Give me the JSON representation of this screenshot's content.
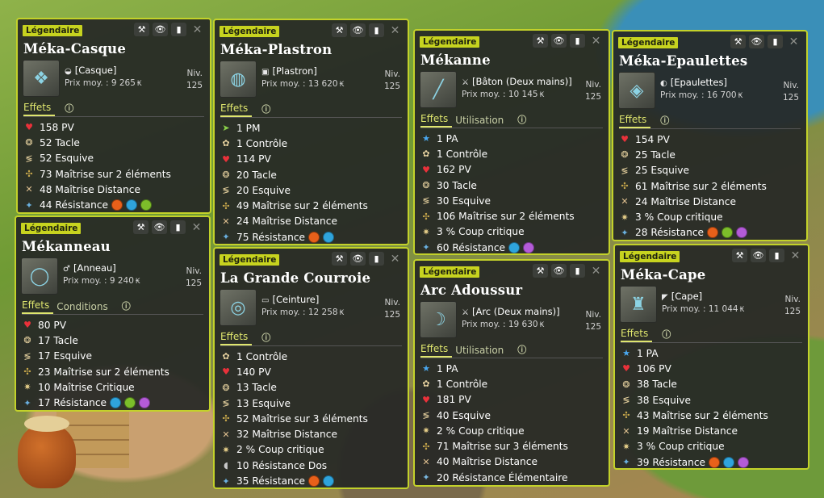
{
  "tooltip_buttons": {
    "craft": "⚒",
    "view": "👁",
    "book": "▮",
    "close": "✕"
  },
  "element_colors": {
    "fire": "#e8601a",
    "water": "#2fa4dc",
    "earth": "#7cbe2a",
    "air": "#b45bd8"
  },
  "stat_icon_glyphs": {
    "pv": "♥",
    "tacle": "❂",
    "esquive": "≶",
    "maitrise": "✣",
    "distance": "✕",
    "resistance": "✦",
    "pm": "➤",
    "controle": "✿",
    "pa": "★",
    "critique": "✷",
    "res_dos": "◖",
    "res_elem": "✦",
    "maitrise_crit": "✷"
  },
  "stat_icon_colors": {
    "pv": "#e9313a",
    "tacle": "#e8d3a0",
    "esquive": "#e8d3a0",
    "maitrise": "#c8a84c",
    "distance": "#e0c090",
    "resistance": "#6ab0e0",
    "pm": "#8bd14a",
    "controle": "#e8d3a0",
    "pa": "#4aa8f0",
    "critique": "#e8d08a",
    "res_dos": "#c8c8c8",
    "res_elem": "#7ab8e0",
    "maitrise_crit": "#e8d08a"
  },
  "items": [
    {
      "rarity": "Légendaire",
      "name": "Méka-Casque",
      "type": "[Casque]",
      "type_icon": "helmet-icon",
      "price_label": "Prix moy. :",
      "price": "9 265",
      "level_label": "Niv.",
      "level": "125",
      "tabs": [
        "Effets"
      ],
      "stats": [
        {
          "icon": "pv",
          "text": "158 PV"
        },
        {
          "icon": "tacle",
          "text": "52 Tacle"
        },
        {
          "icon": "esquive",
          "text": "52 Esquive"
        },
        {
          "icon": "maitrise",
          "text": "73 Maîtrise sur 2 éléments"
        },
        {
          "icon": "distance",
          "text": "48 Maîtrise Distance"
        },
        {
          "icon": "resistance",
          "text": "44 Résistance",
          "elements": [
            "fire",
            "water",
            "earth"
          ]
        }
      ]
    },
    {
      "rarity": "Légendaire",
      "name": "Méka-Plastron",
      "type": "[Plastron]",
      "type_icon": "breastplate-icon",
      "price_label": "Prix moy. :",
      "price": "13 620",
      "level_label": "Niv.",
      "level": "125",
      "tabs": [
        "Effets"
      ],
      "stats": [
        {
          "icon": "pm",
          "text": "1 PM"
        },
        {
          "icon": "controle",
          "text": "1 Contrôle"
        },
        {
          "icon": "pv",
          "text": "114 PV"
        },
        {
          "icon": "tacle",
          "text": "20 Tacle"
        },
        {
          "icon": "esquive",
          "text": "20 Esquive"
        },
        {
          "icon": "maitrise",
          "text": "49 Maîtrise sur 2 éléments"
        },
        {
          "icon": "distance",
          "text": "24 Maîtrise Distance"
        },
        {
          "icon": "resistance",
          "text": "75 Résistance",
          "elements": [
            "fire",
            "water"
          ]
        }
      ]
    },
    {
      "rarity": "Légendaire",
      "name": "Mékanne",
      "type": "[Bâton (Deux mains)]",
      "type_icon": "staff-icon",
      "price_label": "Prix moy. :",
      "price": "10 145",
      "level_label": "Niv.",
      "level": "125",
      "tabs": [
        "Effets",
        "Utilisation"
      ],
      "stats": [
        {
          "icon": "pa",
          "text": "1 PA"
        },
        {
          "icon": "controle",
          "text": "1 Contrôle"
        },
        {
          "icon": "pv",
          "text": "162 PV"
        },
        {
          "icon": "tacle",
          "text": "30 Tacle"
        },
        {
          "icon": "esquive",
          "text": "30 Esquive"
        },
        {
          "icon": "maitrise",
          "text": "106 Maîtrise sur 2 éléments"
        },
        {
          "icon": "critique",
          "text": "3 % Coup critique"
        },
        {
          "icon": "resistance",
          "text": "60 Résistance",
          "elements": [
            "water",
            "air"
          ]
        }
      ]
    },
    {
      "rarity": "Légendaire",
      "name": "Méka-Epaulettes",
      "type": "[Epaulettes]",
      "type_icon": "epaulettes-icon",
      "price_label": "Prix moy. :",
      "price": "16 700",
      "level_label": "Niv.",
      "level": "125",
      "tabs": [
        "Effets"
      ],
      "stats": [
        {
          "icon": "pv",
          "text": "154 PV"
        },
        {
          "icon": "tacle",
          "text": "25 Tacle"
        },
        {
          "icon": "esquive",
          "text": "25 Esquive"
        },
        {
          "icon": "maitrise",
          "text": "61 Maîtrise sur 2 éléments"
        },
        {
          "icon": "distance",
          "text": "24 Maîtrise Distance"
        },
        {
          "icon": "critique",
          "text": "3 % Coup critique"
        },
        {
          "icon": "resistance",
          "text": "28 Résistance",
          "elements": [
            "fire",
            "earth",
            "air"
          ]
        }
      ]
    },
    {
      "rarity": "Légendaire",
      "name": "Mékanneau",
      "type": "[Anneau]",
      "type_icon": "ring-icon",
      "price_label": "Prix moy. :",
      "price": "9 240",
      "level_label": "Niv.",
      "level": "125",
      "tabs": [
        "Effets",
        "Conditions"
      ],
      "stats": [
        {
          "icon": "pv",
          "text": "80 PV"
        },
        {
          "icon": "tacle",
          "text": "17 Tacle"
        },
        {
          "icon": "esquive",
          "text": "17 Esquive"
        },
        {
          "icon": "maitrise",
          "text": "23 Maîtrise sur 2 éléments"
        },
        {
          "icon": "maitrise_crit",
          "text": "10 Maîtrise Critique"
        },
        {
          "icon": "resistance",
          "text": "17 Résistance",
          "elements": [
            "water",
            "earth",
            "air"
          ]
        }
      ]
    },
    {
      "rarity": "Légendaire",
      "name": "La Grande Courroie",
      "type": "[Ceinture]",
      "type_icon": "belt-icon",
      "price_label": "Prix moy. :",
      "price": "12 258",
      "level_label": "Niv.",
      "level": "125",
      "tabs": [
        "Effets"
      ],
      "stats": [
        {
          "icon": "controle",
          "text": "1 Contrôle"
        },
        {
          "icon": "pv",
          "text": "140 PV"
        },
        {
          "icon": "tacle",
          "text": "13 Tacle"
        },
        {
          "icon": "esquive",
          "text": "13 Esquive"
        },
        {
          "icon": "maitrise",
          "text": "52 Maîtrise sur 3 éléments"
        },
        {
          "icon": "distance",
          "text": "32 Maîtrise Distance"
        },
        {
          "icon": "critique",
          "text": "2 % Coup critique"
        },
        {
          "icon": "res_dos",
          "text": "10 Résistance Dos"
        },
        {
          "icon": "resistance",
          "text": "35 Résistance",
          "elements": [
            "fire",
            "water"
          ]
        }
      ]
    },
    {
      "rarity": "Légendaire",
      "name": "Arc Adoussur",
      "type": "[Arc (Deux mains)]",
      "type_icon": "bow-icon",
      "price_label": "Prix moy. :",
      "price": "19 630",
      "level_label": "Niv.",
      "level": "125",
      "tabs": [
        "Effets",
        "Utilisation"
      ],
      "stats": [
        {
          "icon": "pa",
          "text": "1 PA"
        },
        {
          "icon": "controle",
          "text": "1 Contrôle"
        },
        {
          "icon": "pv",
          "text": "181 PV"
        },
        {
          "icon": "esquive",
          "text": "40 Esquive"
        },
        {
          "icon": "critique",
          "text": "2 % Coup critique"
        },
        {
          "icon": "maitrise",
          "text": "71 Maîtrise sur 3 éléments"
        },
        {
          "icon": "distance",
          "text": "40 Maîtrise Distance"
        },
        {
          "icon": "res_elem",
          "text": "20 Résistance Élémentaire"
        }
      ]
    },
    {
      "rarity": "Légendaire",
      "name": "Méka-Cape",
      "type": "[Cape]",
      "type_icon": "cape-icon",
      "price_label": "Prix moy. :",
      "price": "11 044",
      "level_label": "Niv.",
      "level": "125",
      "tabs": [
        "Effets"
      ],
      "stats": [
        {
          "icon": "pa",
          "text": "1 PA"
        },
        {
          "icon": "pv",
          "text": "106 PV"
        },
        {
          "icon": "tacle",
          "text": "38 Tacle"
        },
        {
          "icon": "esquive",
          "text": "38 Esquive"
        },
        {
          "icon": "maitrise",
          "text": "43 Maîtrise sur 2 éléments"
        },
        {
          "icon": "distance",
          "text": "19 Maîtrise Distance"
        },
        {
          "icon": "critique",
          "text": "3 % Coup critique"
        },
        {
          "icon": "resistance",
          "text": "39 Résistance",
          "elements": [
            "fire",
            "water",
            "air"
          ]
        }
      ]
    }
  ]
}
